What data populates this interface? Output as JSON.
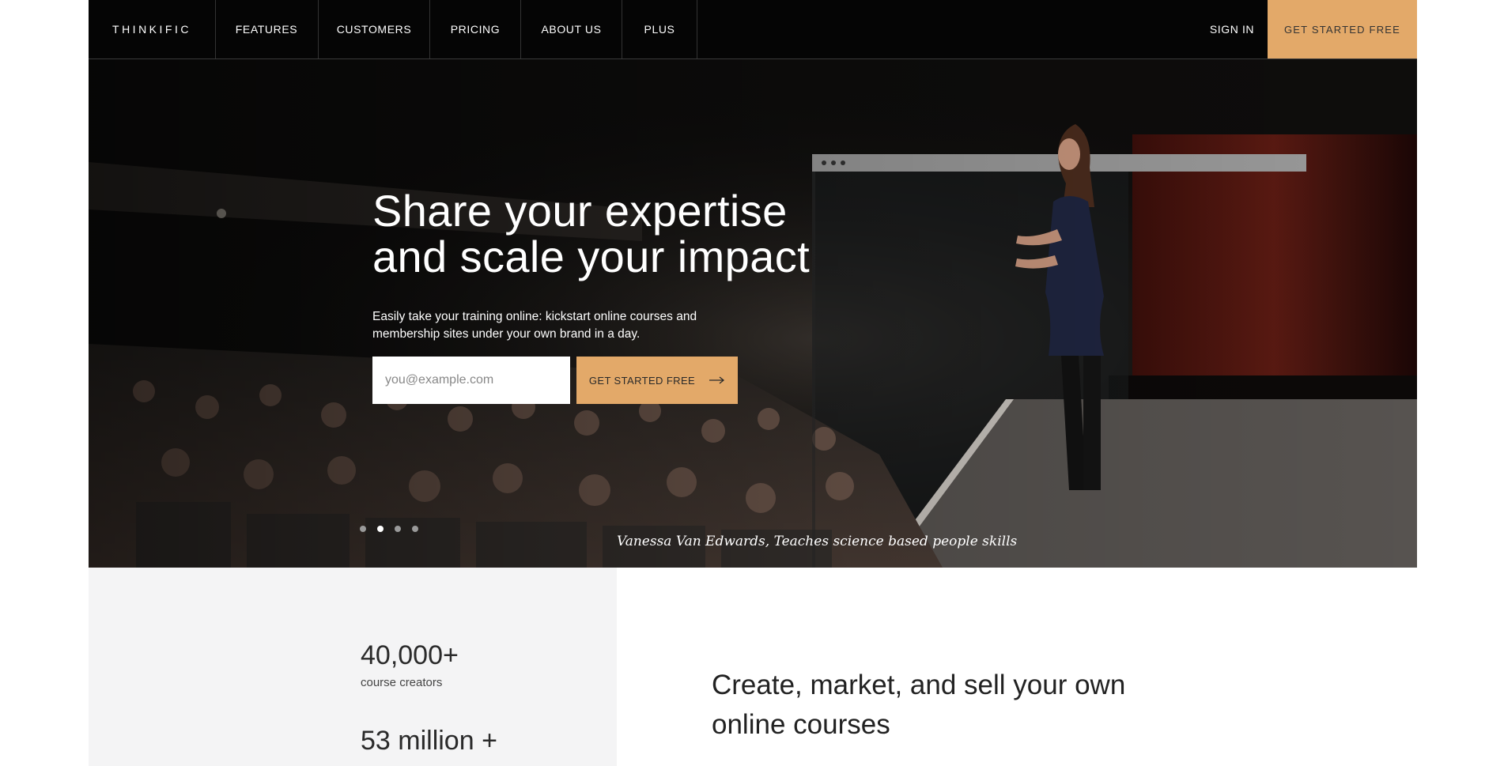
{
  "nav": {
    "logo": "THINKIFIC",
    "links": [
      "FEATURES",
      "CUSTOMERS",
      "PRICING",
      "ABOUT US",
      "PLUS"
    ],
    "sign_in": "SIGN IN",
    "cta": "GET STARTED FREE"
  },
  "hero": {
    "headline_line1": "Share your expertise",
    "headline_line2": "and scale your impact",
    "subtext": "Easily take your training online: kickstart online courses and membership sites under your own brand in a day.",
    "email_placeholder": "you@example.com",
    "cta": "GET STARTED FREE",
    "caption": "Vanessa Van Edwards, Teaches science based people skills",
    "slides": 4,
    "active_slide": 2
  },
  "stats": [
    {
      "value": "40,000+",
      "label": "course creators"
    },
    {
      "value": "53 million +",
      "label": ""
    }
  ],
  "section": {
    "tagline": "Create, market, and sell your own online courses"
  },
  "colors": {
    "accent": "#e3a969",
    "nav_bg": "#050505",
    "stats_bg": "#f4f4f5"
  }
}
